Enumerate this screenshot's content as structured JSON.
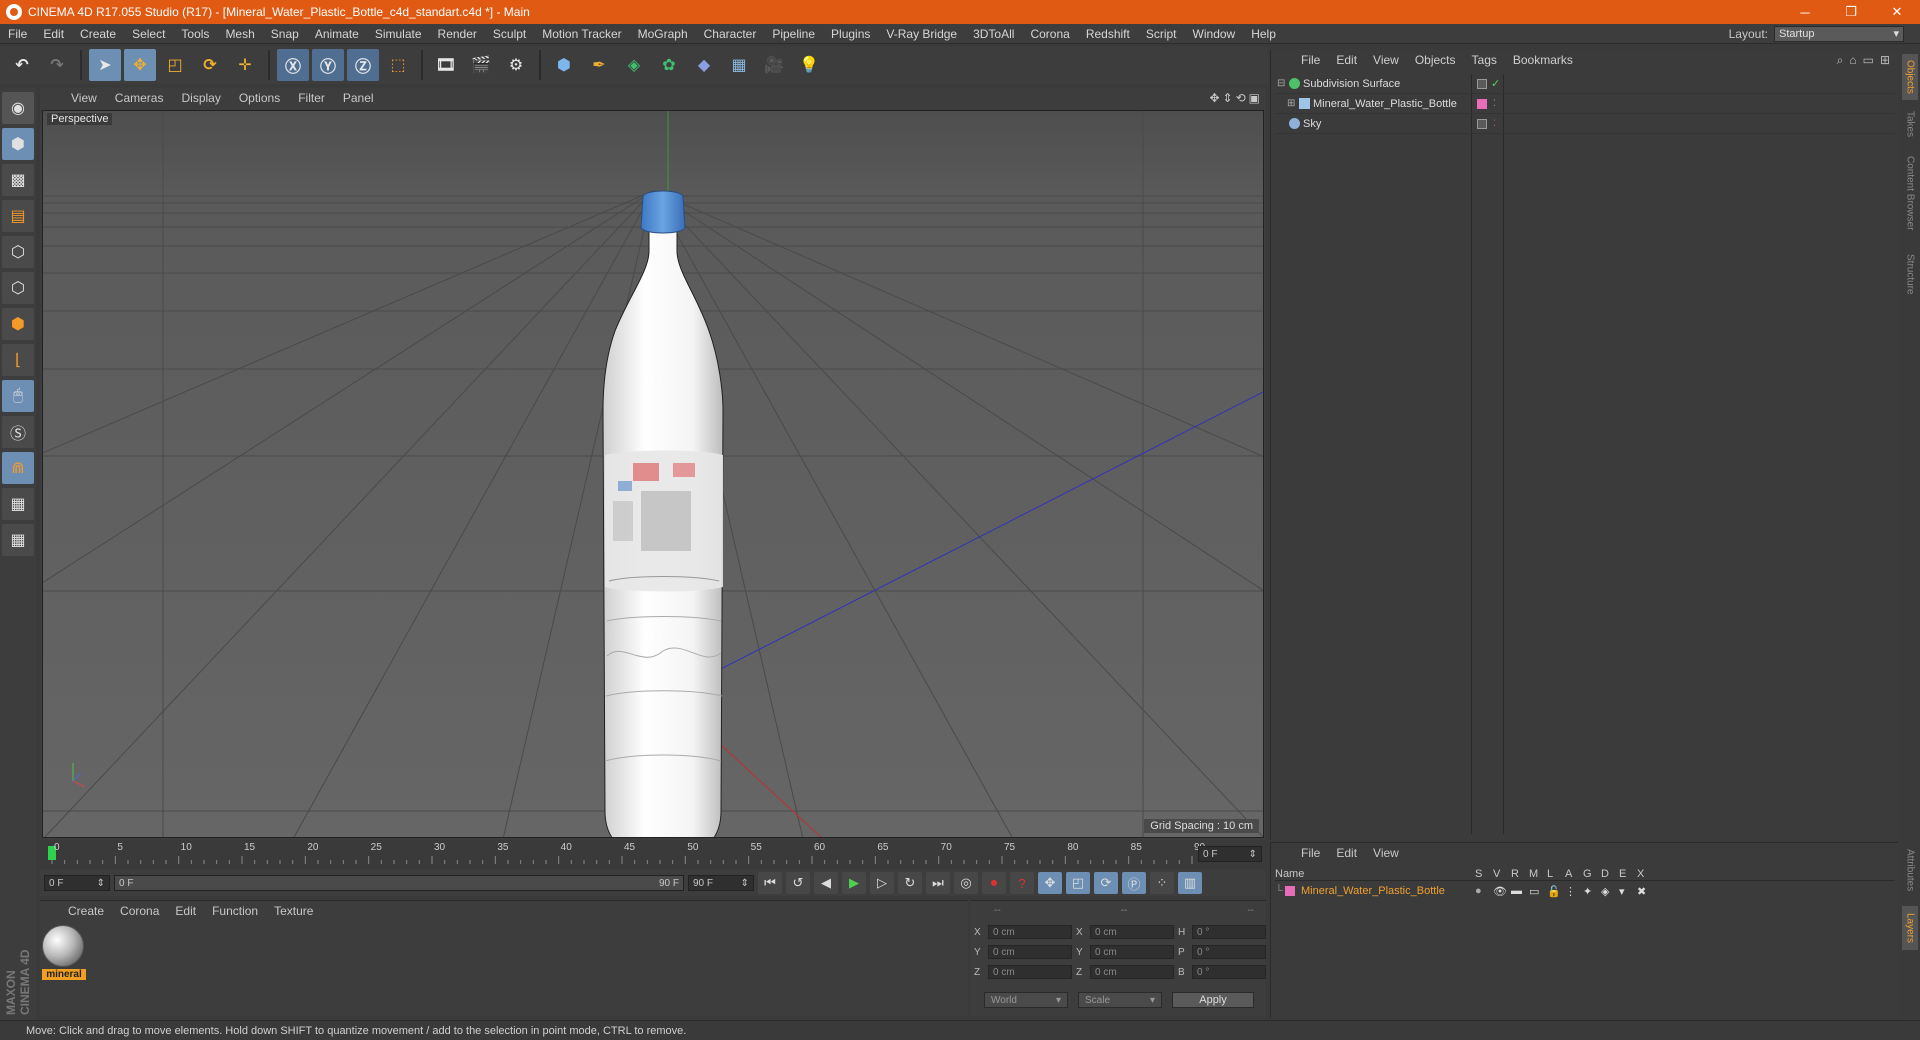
{
  "window": {
    "title": "CINEMA 4D R17.055 Studio (R17) - [Mineral_Water_Plastic_Bottle_c4d_standart.c4d *] - Main",
    "minimize": "─",
    "restore": "❐",
    "close": "✕"
  },
  "menubar": {
    "items": [
      "File",
      "Edit",
      "Create",
      "Select",
      "Tools",
      "Mesh",
      "Snap",
      "Animate",
      "Simulate",
      "Render",
      "Sculpt",
      "Motion Tracker",
      "MoGraph",
      "Character",
      "Pipeline",
      "Plugins",
      "V-Ray Bridge",
      "3DToAll",
      "Corona",
      "Redshift",
      "Script",
      "Window",
      "Help"
    ],
    "layout_label": "Layout:",
    "layout_value": "Startup"
  },
  "viewport": {
    "menu": [
      "View",
      "Cameras",
      "Display",
      "Options",
      "Filter",
      "Panel"
    ],
    "camera_label": "Perspective",
    "grid_spacing": "Grid Spacing : 10 cm",
    "colors": {
      "background": "#5c5c5c",
      "bottle": "#f2f2f2",
      "cap": "#5e95d8"
    }
  },
  "timeline": {
    "ticks": [
      "0",
      "5",
      "10",
      "15",
      "20",
      "25",
      "30",
      "35",
      "40",
      "45",
      "50",
      "55",
      "60",
      "65",
      "70",
      "75",
      "80",
      "85",
      "90"
    ],
    "current_frame": "0 F"
  },
  "transport": {
    "start_field": "0 F",
    "range_start": "0 F",
    "range_end": "90 F",
    "end_field": "90 F"
  },
  "material_panel": {
    "menu": [
      "Create",
      "Corona",
      "Edit",
      "Function",
      "Texture"
    ],
    "material_name": "mineral"
  },
  "coordinates": {
    "header": [
      "--",
      "--",
      "--"
    ],
    "rows": [
      {
        "l1": "X",
        "v1": "0 cm",
        "l2": "X",
        "v2": "0 cm",
        "l3": "H",
        "v3": "0 °"
      },
      {
        "l1": "Y",
        "v1": "0 cm",
        "l2": "Y",
        "v2": "0 cm",
        "l3": "P",
        "v3": "0 °"
      },
      {
        "l1": "Z",
        "v1": "0 cm",
        "l2": "Z",
        "v2": "0 cm",
        "l3": "B",
        "v3": "0 °"
      }
    ],
    "mode": "World",
    "type": "Scale",
    "apply": "Apply"
  },
  "object_manager": {
    "menu": [
      "File",
      "Edit",
      "View",
      "Objects",
      "Tags",
      "Bookmarks"
    ],
    "objects": [
      {
        "name": "Subdivision Surface",
        "icon_color": "#4fc06a"
      },
      {
        "name": "Mineral_Water_Plastic_Bottle",
        "icon_color": "#9fc4e8"
      },
      {
        "name": "Sky",
        "icon_color": "#8fb0d8"
      }
    ]
  },
  "layer_manager": {
    "menu": [
      "File",
      "Edit",
      "View"
    ],
    "columns": [
      "Name",
      "S",
      "V",
      "R",
      "M",
      "L",
      "A",
      "G",
      "D",
      "E",
      "X"
    ],
    "layers": [
      {
        "name": "Mineral_Water_Plastic_Bottle",
        "color": "#e86db8"
      }
    ]
  },
  "side_tabs": [
    "Objects",
    "Takes",
    "Content Browser",
    "Structure",
    "Attributes",
    "Layers"
  ],
  "status": "Move: Click and drag to move elements. Hold down SHIFT to quantize movement / add to the selection in point mode, CTRL to remove."
}
